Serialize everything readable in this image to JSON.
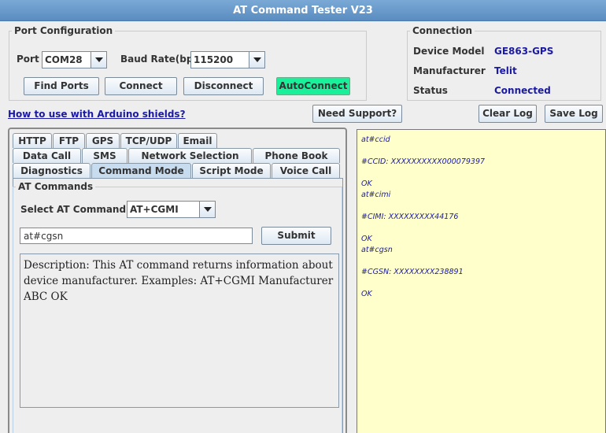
{
  "window": {
    "title": "AT Command Tester V23"
  },
  "port_config": {
    "legend": "Port Configuration",
    "port_label": "Port",
    "port_value": "COM28",
    "baud_label": "Baud Rate(bps)",
    "baud_value": "115200",
    "find_ports": "Find Ports",
    "connect": "Connect",
    "disconnect": "Disconnect",
    "autoconnect": "AutoConnect"
  },
  "connection": {
    "legend": "Connection",
    "device_model_label": "Device Model",
    "device_model_value": "GE863-GPS",
    "manufacturer_label": "Manufacturer",
    "manufacturer_value": "Telit",
    "status_label": "Status",
    "status_value": "Connected"
  },
  "toolbar": {
    "arduino_link": "How to use with Arduino shields?",
    "need_support": "Need Support?",
    "clear_log": "Clear Log",
    "save_log": "Save Log"
  },
  "tabs": {
    "row1": [
      "HTTP",
      "FTP",
      "GPS",
      "TCP/UDP",
      "Email"
    ],
    "row2": [
      "Data Call",
      "SMS",
      "Network Selection",
      "Phone Book"
    ],
    "row3": [
      "Diagnostics",
      "Command Mode",
      "Script Mode",
      "Voice Call"
    ],
    "selected": "Command Mode"
  },
  "at_commands": {
    "legend": "AT Commands",
    "select_label": "Select AT Command",
    "select_value": "AT+CGMI",
    "input_value": "at#cgsn",
    "submit": "Submit",
    "description": "Description: This AT command returns information about device manufacturer. Examples: AT+CGMI Manufacturer ABC OK"
  },
  "log": [
    "at#ccid",
    "",
    "#CCID: XXXXXXXXXX000079397",
    "",
    "OK",
    "at#cimi",
    "",
    "#CIMI: XXXXXXXXX44176",
    "",
    "OK",
    "at#cgsn",
    "",
    "#CGSN: XXXXXXXX238891",
    "",
    "OK"
  ],
  "colors": {
    "accent": "#5a8cc0",
    "autoconnect": "#18f09a",
    "log_bg": "#ffffcc",
    "value_text": "#1a1aa6"
  }
}
